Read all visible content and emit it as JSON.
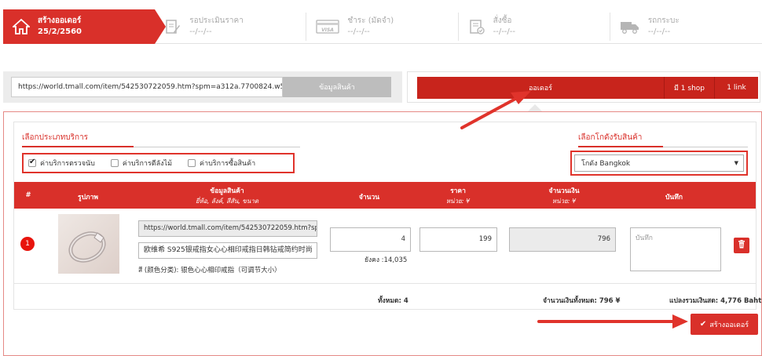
{
  "steps": [
    {
      "title": "สร้างออเดอร์",
      "date": "25/2/2560",
      "icon": "home-icon",
      "active": true
    },
    {
      "title": "รอประเมินราคา",
      "date": "--/--/--",
      "icon": "edit-document-icon",
      "active": false
    },
    {
      "title": "ชำระ (มัดจำ)",
      "date": "--/--/--",
      "icon": "visa-card-icon",
      "active": false
    },
    {
      "title": "สั่งซื้อ",
      "date": "--/--/--",
      "icon": "checklist-icon",
      "active": false
    },
    {
      "title": "รถกระบะ",
      "date": "--/--/--",
      "icon": "truck-icon",
      "active": false
    }
  ],
  "url_bar": {
    "value": "https://world.tmall.com/item/542530722059.htm?spm=a312a.7700824.w500",
    "button_label": "ข้อมูลสินค้า"
  },
  "order_bar": {
    "label": "ออเดอร์",
    "shop_count": "มี 1 shop",
    "link_count": "1 link"
  },
  "service": {
    "title": "เลือกประเภทบริการ",
    "options": [
      {
        "label": "ค่าบริการตรวจนับ",
        "checked": true
      },
      {
        "label": "ค่าบริการตีลังไม้",
        "checked": false
      },
      {
        "label": "ค่าบริการซื้อสินค้า",
        "checked": false
      }
    ]
  },
  "warehouse": {
    "title": "เลือกโกดังรับสินค้า",
    "selected": "โกดัง Bangkok"
  },
  "table": {
    "headers": {
      "num": "#",
      "image": "รูปภาพ",
      "info": "ข้อมูลสินค้า",
      "info_sub": "ยี่ห้อ, ลังค์, สีสัน, ขนาด",
      "qty": "จำนวน",
      "price": "ราคา",
      "price_sub": "หน่วย: ¥",
      "amount": "จำนวนเงิน",
      "amount_sub": "หน่วย: ¥",
      "note": "บันทึก"
    },
    "rows": [
      {
        "index": "1",
        "url": "https://world.tmall.com/item/542530722059.htm?sp",
        "name": "欧维希 S925银戒指女心心相印戒指日韩钻戒简约时尚",
        "attr": "สี (颜色分类): 银色心心相印戒指（可调节大小）",
        "qty": "4",
        "stock": "ยังคง :14,035",
        "price": "199",
        "amount": "796",
        "note_placeholder": "บันทึก"
      }
    ],
    "footer": {
      "total_qty": "ทั้งหมด: 4",
      "total_amount": "จำนวนเงินทั้งหมด: 796 ¥",
      "total_baht": "แปลงรวมเงินสด: 4,776 Baht"
    }
  },
  "create_button": "สร้างออเดอร์",
  "colors": {
    "accent": "#d9302a",
    "annotation": "#e0332b"
  }
}
